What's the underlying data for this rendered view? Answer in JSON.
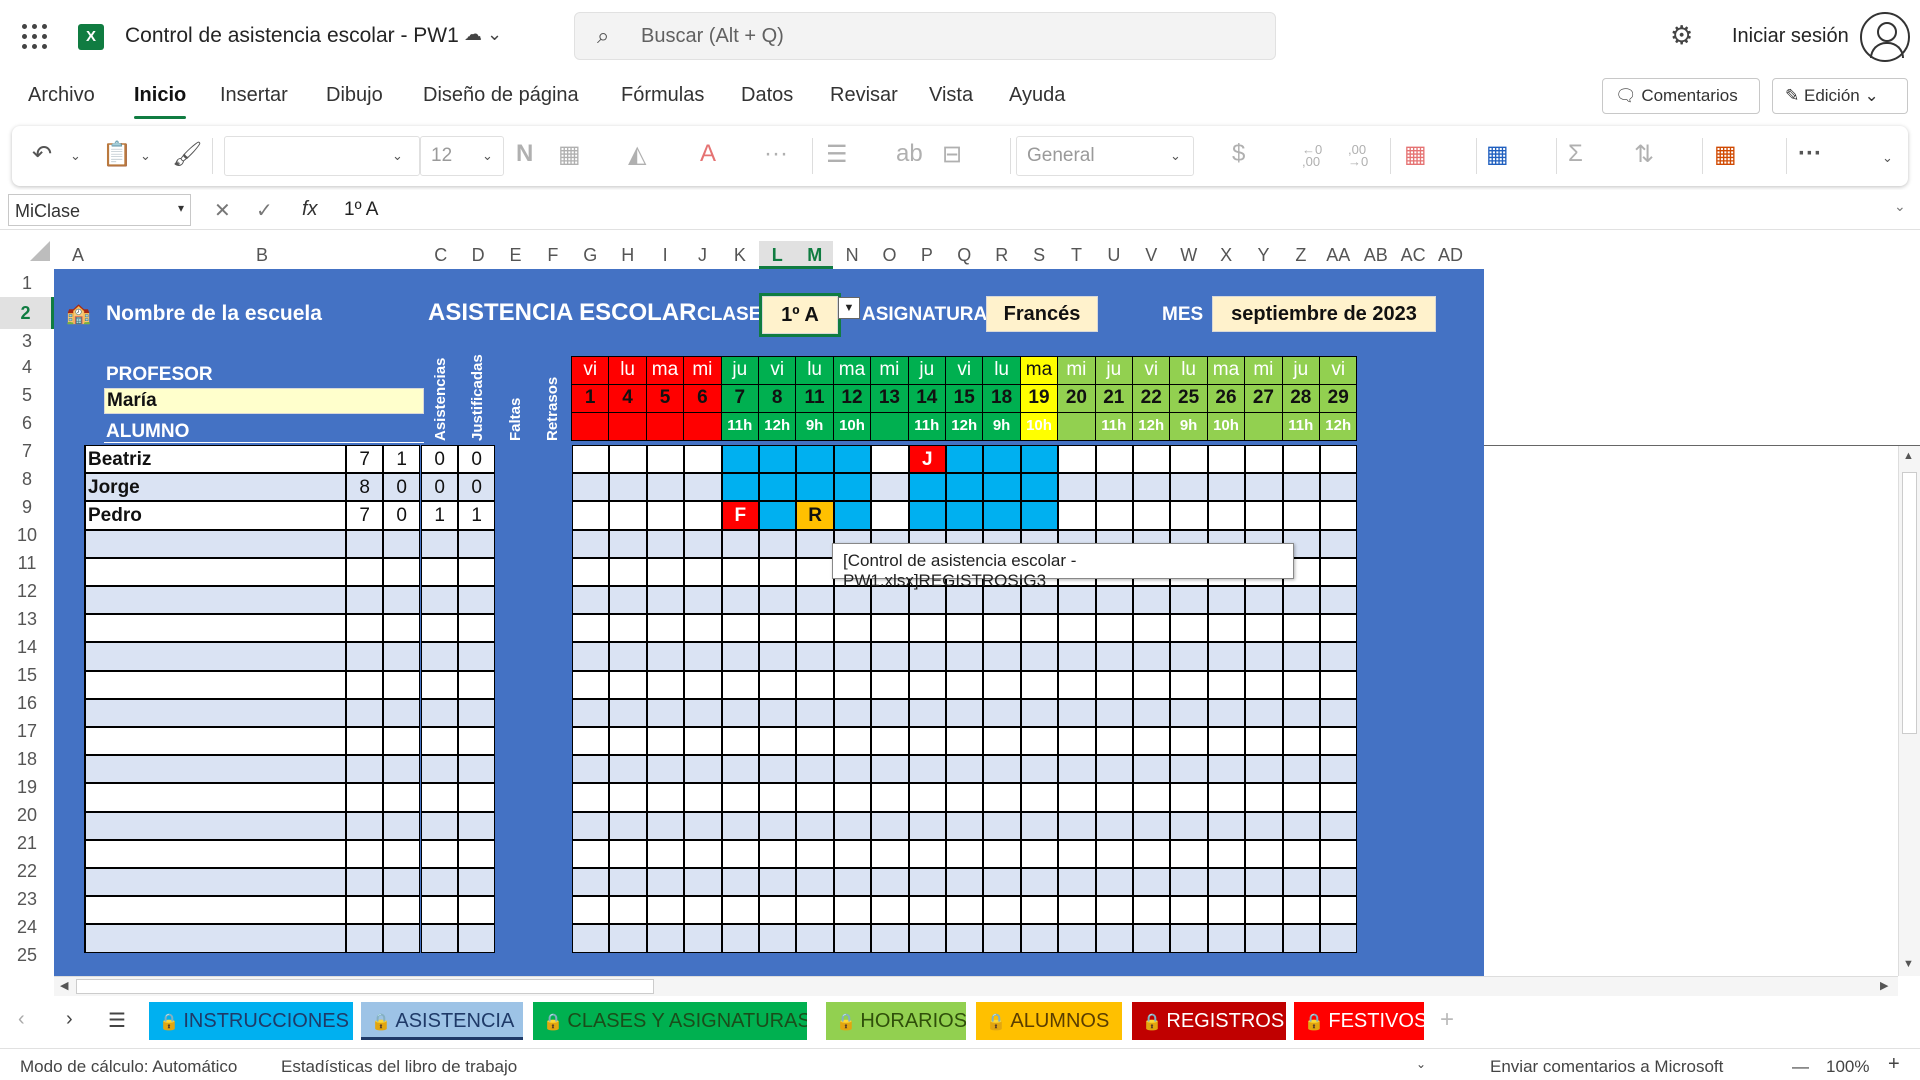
{
  "app": {
    "title": "Control de asistencia escolar - PW1",
    "search_placeholder": "Buscar (Alt + Q)",
    "signin": "Iniciar sesión"
  },
  "menu": [
    "Archivo",
    "Inicio",
    "Insertar",
    "Dibujo",
    "Diseño de página",
    "Fórmulas",
    "Datos",
    "Revisar",
    "Vista",
    "Ayuda"
  ],
  "buttons": {
    "comments": "Comentarios",
    "editing": "Edición"
  },
  "ribbon": {
    "font_size": "12",
    "bold": "N",
    "number_format": "General",
    "currency": "$",
    "dec_inc": "←0\n,00",
    "dec_dec": ",00\n→0"
  },
  "formula_bar": {
    "name_box": "MiClase",
    "fx": "fx",
    "value": "1º A"
  },
  "columns": [
    "A",
    "B",
    "C",
    "D",
    "E",
    "F",
    "G",
    "H",
    "I",
    "J",
    "K",
    "L",
    "M",
    "N",
    "O",
    "P",
    "Q",
    "R",
    "S",
    "T",
    "U",
    "V",
    "W",
    "X",
    "Y",
    "Z",
    "AA",
    "AB",
    "AC",
    "AD"
  ],
  "rows": [
    "1",
    "2",
    "3",
    "4",
    "5",
    "6",
    "7",
    "8",
    "9",
    "10",
    "11",
    "12",
    "13",
    "14",
    "15",
    "16",
    "17",
    "18",
    "19",
    "20",
    "21",
    "22",
    "23",
    "24",
    "25"
  ],
  "sheet": {
    "school": "Nombre de la escuela",
    "heading": "ASISTENCIA ESCOLAR",
    "class_label": "CLASE",
    "class_value": "1º A",
    "subject_label": "ASIGNATURA",
    "subject_value": "Francés",
    "month_label": "MES",
    "month_value": "septiembre de 2023",
    "teacher_label": "PROFESOR",
    "teacher_value": "María",
    "student_label": "ALUMNO",
    "stat_headers": [
      "Asistencias",
      "Justificadas",
      "Faltas",
      "Retrasos"
    ],
    "days": [
      {
        "dow": "vi",
        "d": "1",
        "h": "",
        "c": "red"
      },
      {
        "dow": "lu",
        "d": "4",
        "h": "",
        "c": "red"
      },
      {
        "dow": "ma",
        "d": "5",
        "h": "",
        "c": "red"
      },
      {
        "dow": "mi",
        "d": "6",
        "h": "",
        "c": "red"
      },
      {
        "dow": "ju",
        "d": "7",
        "h": "11h",
        "c": "green"
      },
      {
        "dow": "vi",
        "d": "8",
        "h": "12h",
        "c": "green"
      },
      {
        "dow": "lu",
        "d": "11",
        "h": "9h",
        "c": "green"
      },
      {
        "dow": "ma",
        "d": "12",
        "h": "10h",
        "c": "green"
      },
      {
        "dow": "mi",
        "d": "13",
        "h": "",
        "c": "green"
      },
      {
        "dow": "ju",
        "d": "14",
        "h": "11h",
        "c": "green"
      },
      {
        "dow": "vi",
        "d": "15",
        "h": "12h",
        "c": "green"
      },
      {
        "dow": "lu",
        "d": "18",
        "h": "9h",
        "c": "green"
      },
      {
        "dow": "ma",
        "d": "19",
        "h": "10h",
        "c": "yellow"
      },
      {
        "dow": "mi",
        "d": "20",
        "h": "",
        "c": "lightgreen"
      },
      {
        "dow": "ju",
        "d": "21",
        "h": "11h",
        "c": "lightgreen"
      },
      {
        "dow": "vi",
        "d": "22",
        "h": "12h",
        "c": "lightgreen"
      },
      {
        "dow": "lu",
        "d": "25",
        "h": "9h",
        "c": "lightgreen"
      },
      {
        "dow": "ma",
        "d": "26",
        "h": "10h",
        "c": "lightgreen"
      },
      {
        "dow": "mi",
        "d": "27",
        "h": "",
        "c": "lightgreen"
      },
      {
        "dow": "ju",
        "d": "28",
        "h": "11h",
        "c": "lightgreen"
      },
      {
        "dow": "vi",
        "d": "29",
        "h": "12h",
        "c": "lightgreen"
      }
    ],
    "students": [
      {
        "name": "Beatriz",
        "stats": [
          "7",
          "1",
          "0",
          "0"
        ],
        "marks": [
          "",
          "",
          "",
          "",
          "b",
          "b",
          "b",
          "b",
          "",
          "J",
          "b",
          "b",
          "b",
          "",
          "",
          "",
          "",
          "",
          "",
          "",
          ""
        ]
      },
      {
        "name": "Jorge",
        "stats": [
          "8",
          "0",
          "0",
          "0"
        ],
        "marks": [
          "",
          "",
          "",
          "",
          "b",
          "b",
          "b",
          "b",
          "",
          "b",
          "b",
          "b",
          "b",
          "",
          "",
          "",
          "",
          "",
          "",
          "",
          ""
        ]
      },
      {
        "name": "Pedro",
        "stats": [
          "7",
          "0",
          "1",
          "1"
        ],
        "marks": [
          "",
          "",
          "",
          "",
          "F",
          "b",
          "R",
          "b",
          "",
          "b",
          "b",
          "b",
          "b",
          "",
          "",
          "",
          "",
          "",
          "",
          "",
          ""
        ]
      }
    ],
    "empty_rows": 15,
    "tooltip": "[Control de asistencia escolar - PW1.xlsx]REGISTROS!G3"
  },
  "sheet_tabs": [
    {
      "label": "INSTRUCCIONES",
      "bg": "#00b0f0",
      "fg": "#1f3a68"
    },
    {
      "label": "ASISTENCIA",
      "bg": "#9dc3e6",
      "fg": "#1f3a68"
    },
    {
      "label": "CLASES Y ASIGNATURAS",
      "bg": "#00b050",
      "fg": "#1a4d1a"
    },
    {
      "label": "HORARIOS",
      "bg": "#92d050",
      "fg": "#2f4f0a"
    },
    {
      "label": "ALUMNOS",
      "bg": "#ffc000",
      "fg": "#5a3d00"
    },
    {
      "label": "REGISTROS",
      "bg": "#c00000",
      "fg": "#ffffff"
    },
    {
      "label": "FESTIVOS",
      "bg": "#ff0000",
      "fg": "#ffffff"
    }
  ],
  "status": {
    "calc": "Modo de cálculo: Automático",
    "stats": "Estadísticas del libro de trabajo",
    "feedback": "Enviar comentarios a Microsoft",
    "zoom": "100%"
  },
  "colors": {
    "red": "#ff0000",
    "green": "#00b050",
    "yellow": "#ffff00",
    "lightgreen": "#92d050",
    "blue": "#00b0f0",
    "orange": "#ffc000",
    "sheet_bg": "#4472c4"
  }
}
